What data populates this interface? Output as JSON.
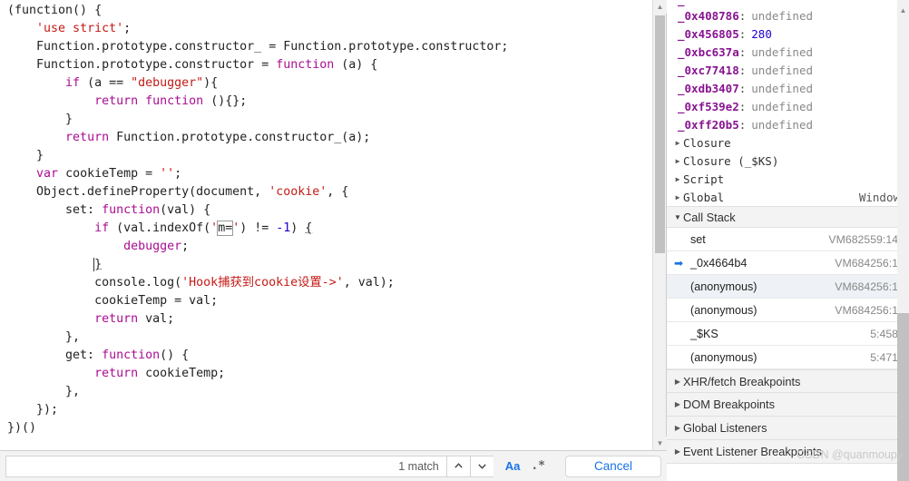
{
  "editor": {
    "language": "javascript",
    "code_lines": [
      [
        {
          "t": "(function() {",
          "c": "plain"
        }
      ],
      [
        {
          "t": "    ",
          "c": "plain"
        },
        {
          "t": "'use strict'",
          "c": "str"
        },
        {
          "t": ";",
          "c": "plain"
        }
      ],
      [
        {
          "t": "    Function.prototype.constructor_ = Function.prototype.constructor;",
          "c": "plain"
        }
      ],
      [
        {
          "t": "    Function.prototype.constructor = ",
          "c": "plain"
        },
        {
          "t": "function",
          "c": "kw"
        },
        {
          "t": " (a) {",
          "c": "plain"
        }
      ],
      [
        {
          "t": "        ",
          "c": "plain"
        },
        {
          "t": "if",
          "c": "kw"
        },
        {
          "t": " (a == ",
          "c": "plain"
        },
        {
          "t": "\"debugger\"",
          "c": "str"
        },
        {
          "t": "){",
          "c": "plain"
        }
      ],
      [
        {
          "t": "            ",
          "c": "plain"
        },
        {
          "t": "return",
          "c": "kw"
        },
        {
          "t": " ",
          "c": "plain"
        },
        {
          "t": "function",
          "c": "kw"
        },
        {
          "t": " (){};",
          "c": "plain"
        }
      ],
      [
        {
          "t": "        }",
          "c": "plain"
        }
      ],
      [
        {
          "t": "        ",
          "c": "plain"
        },
        {
          "t": "return",
          "c": "kw"
        },
        {
          "t": " Function.prototype.constructor_(a);",
          "c": "plain"
        }
      ],
      [
        {
          "t": "    }",
          "c": "plain"
        }
      ],
      [
        {
          "t": "    ",
          "c": "plain"
        },
        {
          "t": "var",
          "c": "kw"
        },
        {
          "t": " cookieTemp = ",
          "c": "plain"
        },
        {
          "t": "''",
          "c": "str"
        },
        {
          "t": ";",
          "c": "plain"
        }
      ],
      [
        {
          "t": "    Object.defineProperty(document, ",
          "c": "plain"
        },
        {
          "t": "'cookie'",
          "c": "str"
        },
        {
          "t": ", {",
          "c": "plain"
        }
      ],
      [
        {
          "t": "        set: ",
          "c": "plain"
        },
        {
          "t": "function",
          "c": "kw"
        },
        {
          "t": "(val) {",
          "c": "plain"
        }
      ],
      [
        {
          "t": "            ",
          "c": "plain"
        },
        {
          "t": "if",
          "c": "kw"
        },
        {
          "t": " (val.indexOf(",
          "c": "plain"
        },
        {
          "t": "'",
          "c": "str"
        },
        {
          "t": "m=",
          "c": "match"
        },
        {
          "t": "'",
          "c": "str"
        },
        {
          "t": ") != ",
          "c": "plain"
        },
        {
          "t": "-1",
          "c": "num"
        },
        {
          "t": ") ",
          "c": "plain"
        },
        {
          "t": "{",
          "c": "brace"
        }
      ],
      [
        {
          "t": "                ",
          "c": "plain"
        },
        {
          "t": "debugger",
          "c": "kw"
        },
        {
          "t": ";",
          "c": "plain"
        }
      ],
      [
        {
          "t": "            ",
          "c": "plain"
        },
        {
          "t": "}",
          "c": "brace-cursor"
        }
      ],
      [
        {
          "t": "            console.log(",
          "c": "plain"
        },
        {
          "t": "'Hook捕获到cookie设置->'",
          "c": "str"
        },
        {
          "t": ", val);",
          "c": "plain"
        }
      ],
      [
        {
          "t": "            cookieTemp = val;",
          "c": "plain"
        }
      ],
      [
        {
          "t": "            ",
          "c": "plain"
        },
        {
          "t": "return",
          "c": "kw"
        },
        {
          "t": " val;",
          "c": "plain"
        }
      ],
      [
        {
          "t": "        },",
          "c": "plain"
        }
      ],
      [
        {
          "t": "        get: ",
          "c": "plain"
        },
        {
          "t": "function",
          "c": "kw"
        },
        {
          "t": "() {",
          "c": "plain"
        }
      ],
      [
        {
          "t": "            ",
          "c": "plain"
        },
        {
          "t": "return",
          "c": "kw"
        },
        {
          "t": " cookieTemp;",
          "c": "plain"
        }
      ],
      [
        {
          "t": "        },",
          "c": "plain"
        }
      ],
      [
        {
          "t": "    });",
          "c": "plain"
        }
      ],
      [
        {
          "t": "})()",
          "c": "plain"
        }
      ]
    ]
  },
  "search": {
    "value": "",
    "placeholder": "",
    "match_count_label": "1 match",
    "prev_icon": "chevron-up-icon",
    "next_icon": "chevron-down-icon",
    "match_case_label": "Aa",
    "regex_label": ".*",
    "cancel_label": "Cancel"
  },
  "sidebar": {
    "scope_variables": [
      {
        "name": "_0x408786",
        "value": "undefined",
        "kind": "undefined"
      },
      {
        "name": "_0x456805",
        "value": "280",
        "kind": "number"
      },
      {
        "name": "_0xbc637a",
        "value": "undefined",
        "kind": "undefined"
      },
      {
        "name": "_0xc77418",
        "value": "undefined",
        "kind": "undefined"
      },
      {
        "name": "_0xdb3407",
        "value": "undefined",
        "kind": "undefined"
      },
      {
        "name": "_0xf539e2",
        "value": "undefined",
        "kind": "undefined"
      },
      {
        "name": "_0xff20b5",
        "value": "undefined",
        "kind": "undefined"
      }
    ],
    "scope_groups": [
      {
        "label": "Closure",
        "value": "",
        "expanded": false
      },
      {
        "label": "Closure (_$KS)",
        "value": "",
        "expanded": false
      },
      {
        "label": "Script",
        "value": "",
        "expanded": false
      },
      {
        "label": "Global",
        "value": "Window",
        "expanded": false
      }
    ],
    "call_stack": {
      "header": "Call Stack",
      "expanded": true,
      "frames": [
        {
          "fn": "set",
          "location": "VM682559:14",
          "selected": false,
          "current": false
        },
        {
          "fn": "_0x4664b4",
          "location": "VM684256:1",
          "selected": false,
          "current": true
        },
        {
          "fn": "(anonymous)",
          "location": "VM684256:1",
          "selected": true,
          "current": false
        },
        {
          "fn": "(anonymous)",
          "location": "VM684256:1",
          "selected": false,
          "current": false
        },
        {
          "fn": "_$KS",
          "location": "5:458",
          "selected": false,
          "current": false
        },
        {
          "fn": "(anonymous)",
          "location": "5:471",
          "selected": false,
          "current": false
        }
      ]
    },
    "breakpoint_sections": [
      {
        "label": "XHR/fetch Breakpoints",
        "expanded": false
      },
      {
        "label": "DOM Breakpoints",
        "expanded": false
      },
      {
        "label": "Global Listeners",
        "expanded": false
      },
      {
        "label": "Event Listener Breakpoints",
        "expanded": false
      }
    ]
  },
  "watermark": {
    "text": "CSDN @quanmoupy"
  },
  "colors": {
    "keyword": "#aa0d91",
    "string": "#c41a16",
    "number": "#1c00cf",
    "variable_name": "#881391",
    "accent": "#1a73e8",
    "muted": "#888888"
  }
}
